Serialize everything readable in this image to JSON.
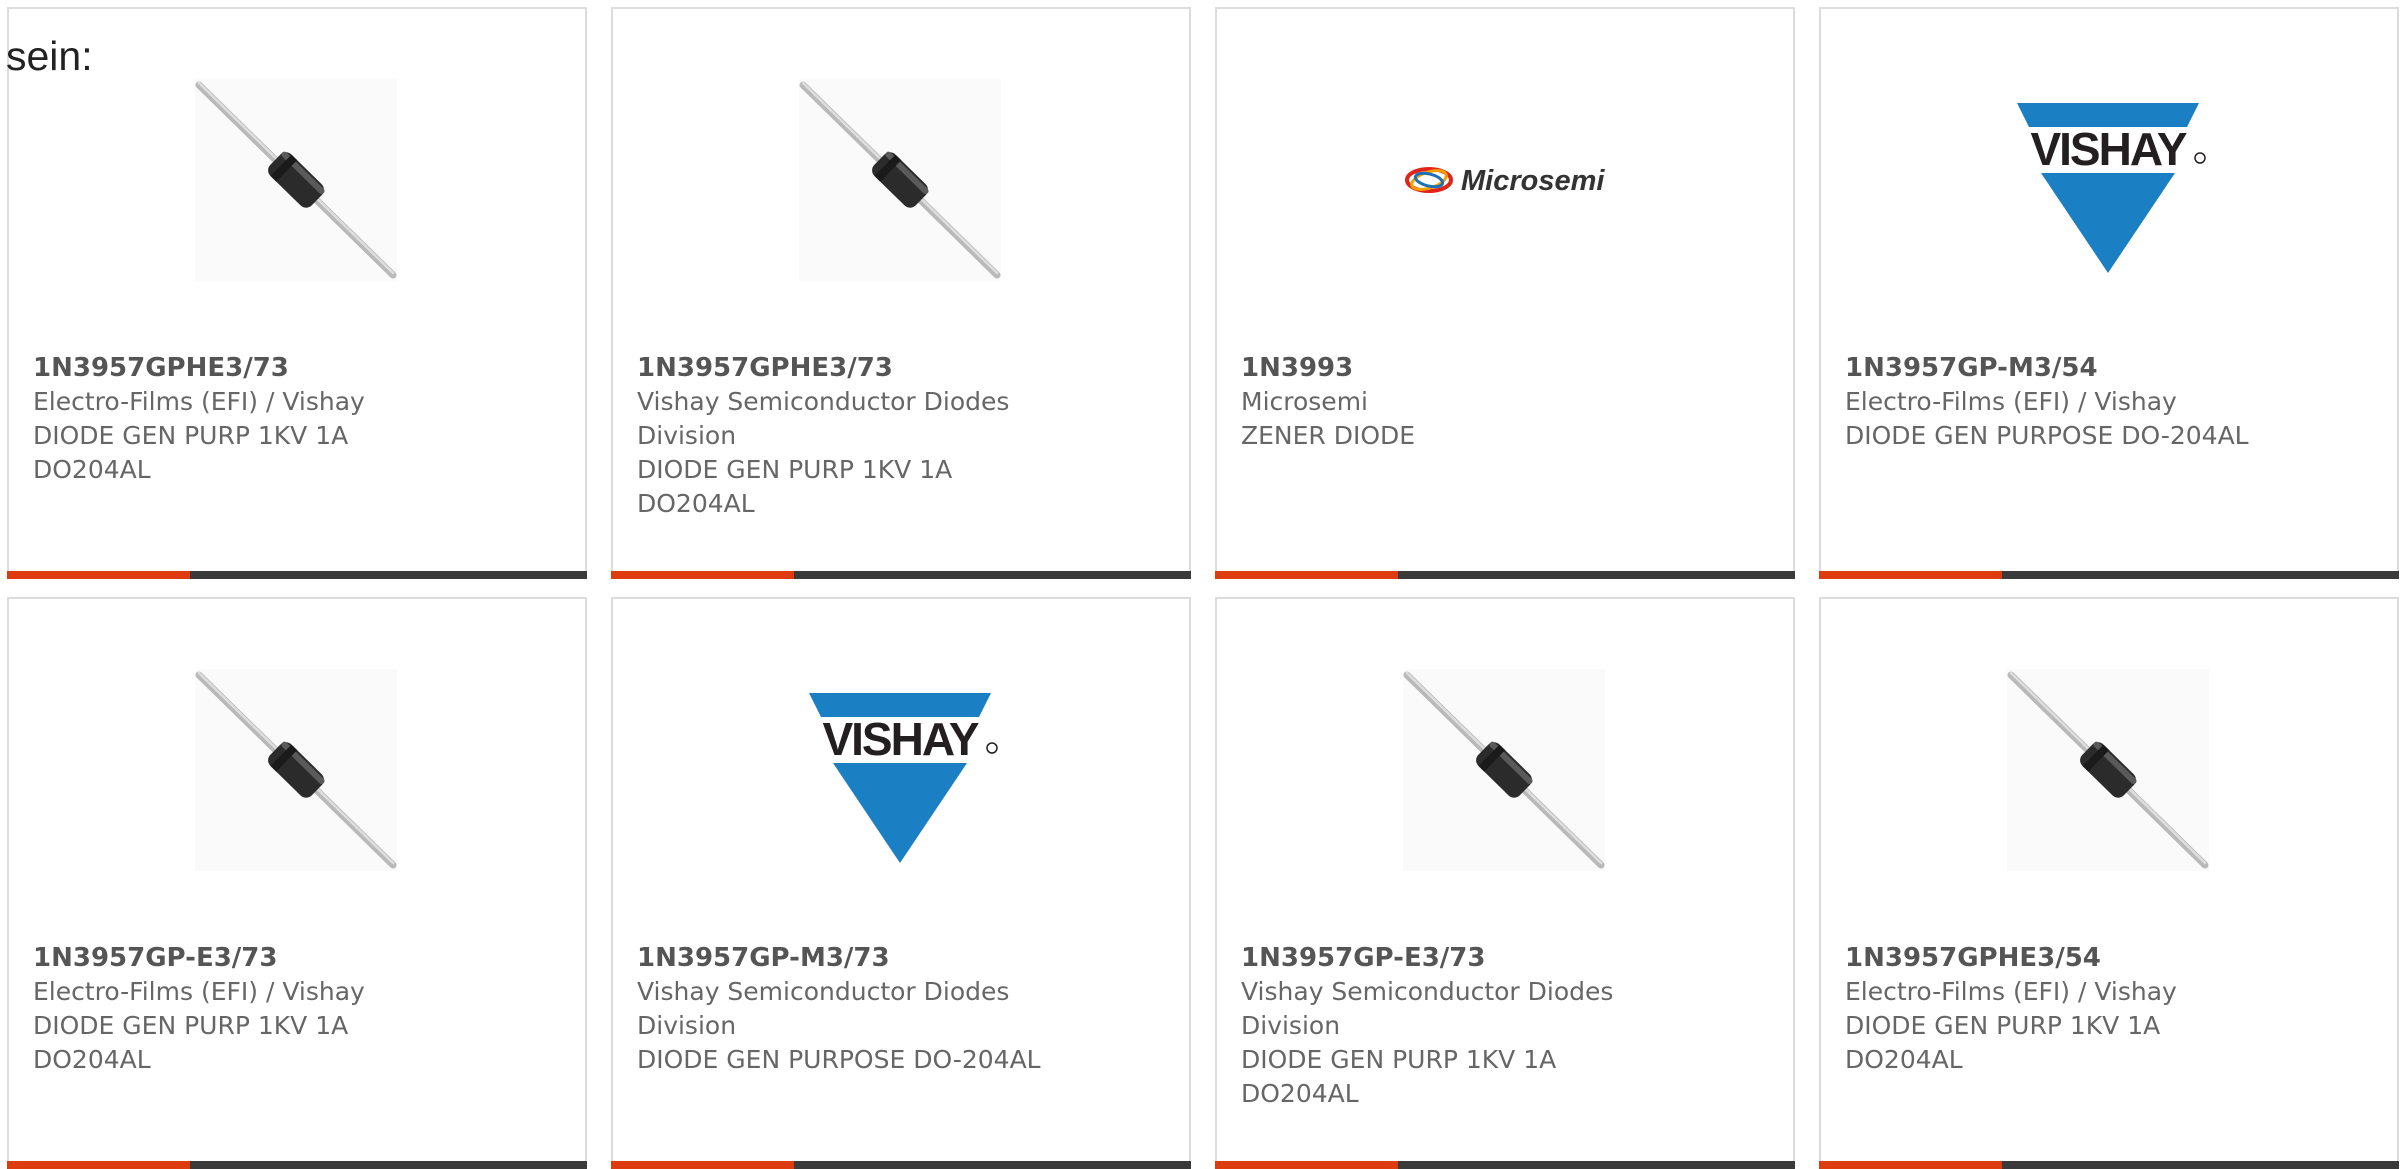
{
  "intro_text": "sein:",
  "colors": {
    "accent": "#de3c0e",
    "bar": "#3a3a3a",
    "vishay_blue": "#1b7fc4"
  },
  "products": [
    {
      "part_number": "1N3957GPHE3/73",
      "manufacturer": "Electro-Films (EFI) / Vishay",
      "description": "DIODE GEN PURP 1KV 1A DO204AL",
      "image": "diode-photo"
    },
    {
      "part_number": "1N3957GPHE3/73",
      "manufacturer": "Vishay Semiconductor Diodes Division",
      "description": "DIODE GEN PURP 1KV 1A DO204AL",
      "image": "diode-photo"
    },
    {
      "part_number": "1N3993",
      "manufacturer": "Microsemi",
      "description": "ZENER DIODE",
      "image": "microsemi-logo",
      "logo_text": "Microsemi"
    },
    {
      "part_number": "1N3957GP-M3/54",
      "manufacturer": "Electro-Films (EFI) / Vishay",
      "description": "DIODE GEN PURPOSE DO-204AL",
      "image": "vishay-logo",
      "logo_text": "VISHAY"
    },
    {
      "part_number": "1N3957GP-E3/73",
      "manufacturer": "Electro-Films (EFI) / Vishay",
      "description": "DIODE GEN PURP 1KV 1A DO204AL",
      "image": "diode-photo"
    },
    {
      "part_number": "1N3957GP-M3/73",
      "manufacturer": "Vishay Semiconductor Diodes Division",
      "description": "DIODE GEN PURPOSE DO-204AL",
      "image": "vishay-logo",
      "logo_text": "VISHAY"
    },
    {
      "part_number": "1N3957GP-E3/73",
      "manufacturer": "Vishay Semiconductor Diodes Division",
      "description": "DIODE GEN PURP 1KV 1A DO204AL",
      "image": "diode-photo"
    },
    {
      "part_number": "1N3957GPHE3/54",
      "manufacturer": "Electro-Films (EFI) / Vishay",
      "description": "DIODE GEN PURP 1KV 1A DO204AL",
      "image": "diode-photo"
    }
  ]
}
